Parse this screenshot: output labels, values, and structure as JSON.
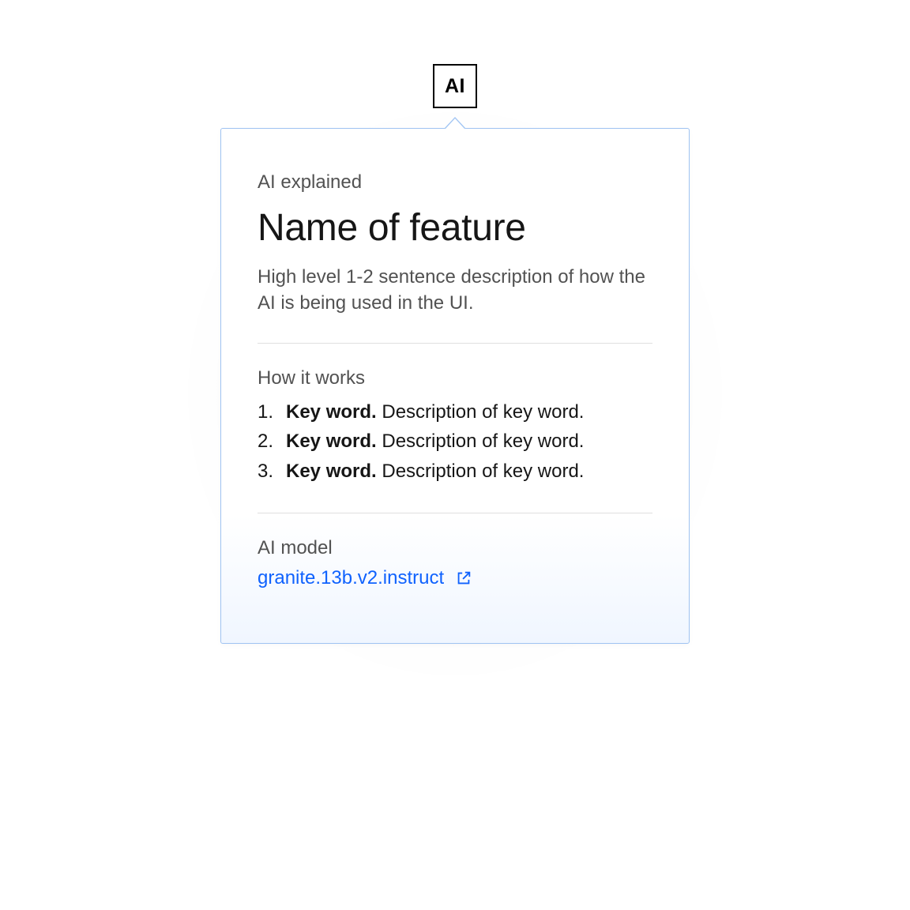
{
  "badge": {
    "label": "AI"
  },
  "popover": {
    "overline": "AI explained",
    "title": "Name of feature",
    "description": "High level 1-2 sentence description of how the AI is being used in the UI.",
    "how_label": "How it works",
    "how_items": [
      {
        "key": "Key word.",
        "desc": " Description of key word."
      },
      {
        "key": "Key word.",
        "desc": " Description of key word."
      },
      {
        "key": "Key word.",
        "desc": " Description of key word."
      }
    ],
    "model_label": "AI model",
    "model_link_text": "granite.13b.v2.instruct"
  }
}
